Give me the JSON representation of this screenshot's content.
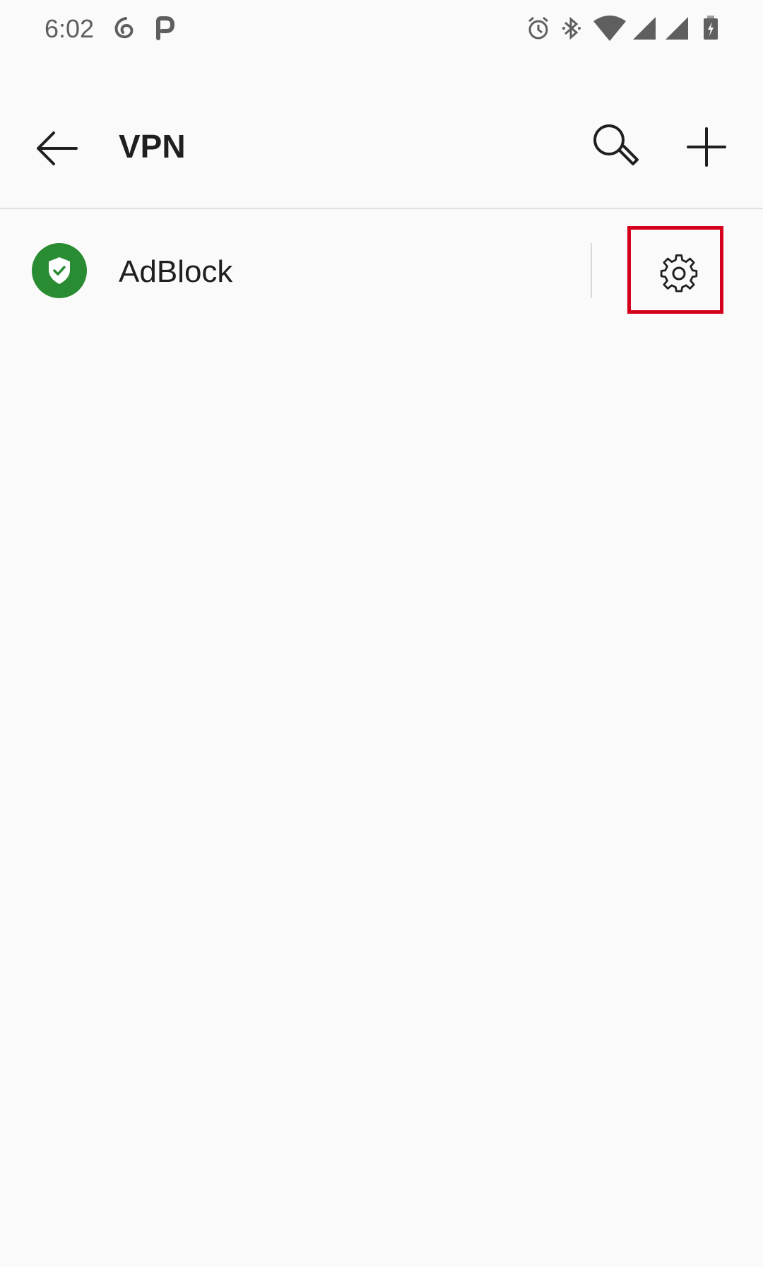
{
  "status_bar": {
    "time": "6:02",
    "icons": [
      "netease-music-icon",
      "parking-p-icon",
      "alarm-icon",
      "bluetooth-icon",
      "wifi-icon",
      "signal-icon",
      "signal-icon-2",
      "battery-charging-icon"
    ]
  },
  "app_bar": {
    "title": "VPN",
    "back_icon": "arrow-back-icon",
    "search_icon": "search-icon",
    "add_icon": "plus-icon"
  },
  "vpn_list": [
    {
      "name": "AdBlock",
      "icon": "shield-check-icon",
      "icon_color": "#2a8c32",
      "settings_icon": "gear-icon"
    }
  ],
  "colors": {
    "background": "#fafafa",
    "highlight": "#d5001c",
    "accent_green": "#2a8c32"
  }
}
